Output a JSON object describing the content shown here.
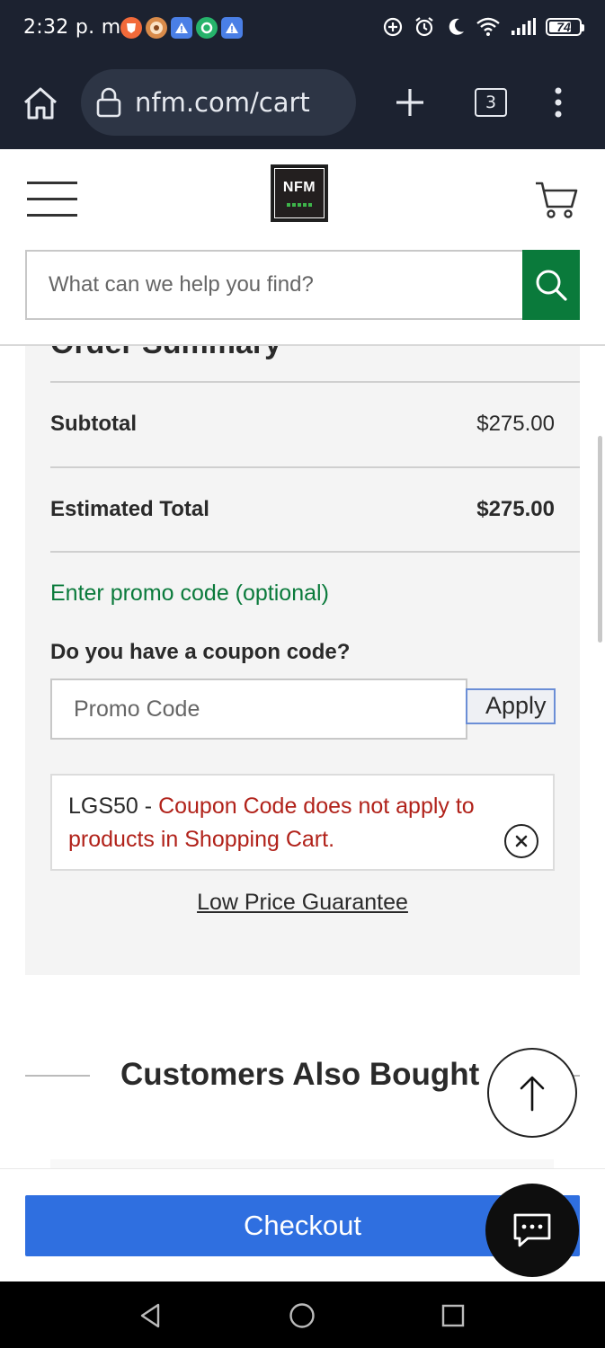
{
  "status_bar": {
    "time": "2:32 p. m.",
    "battery": "74",
    "battery_level": 0.74,
    "left_icons": [
      "brave-icon",
      "chrome-icon",
      "alert-icon",
      "circle-app-icon",
      "alert-icon"
    ],
    "right_icons": [
      "data-saver-icon",
      "alarm-icon",
      "moon-icon",
      "wifi-icon",
      "signal-icon",
      "battery-icon"
    ]
  },
  "browser": {
    "url": "nfm.com/cart",
    "tab_count": "3"
  },
  "site": {
    "logo_text": "NFM",
    "search_placeholder": "What can we help you find?"
  },
  "order_summary": {
    "title": "Order Summary",
    "subtotal_label": "Subtotal",
    "subtotal_value": "$275.00",
    "total_label": "Estimated Total",
    "total_value": "$275.00",
    "promo_link": "Enter promo code (optional)",
    "coupon_question": "Do you have a coupon code?",
    "promo_placeholder": "Promo Code",
    "apply_label": "Apply",
    "error_code": "LGS50 - ",
    "error_message": "Coupon Code does not apply to products in Shopping Cart.",
    "low_price_link": "Low Price Guarantee"
  },
  "recommendations": {
    "title": "Customers Also Bought"
  },
  "checkout": {
    "label": "Checkout"
  },
  "colors": {
    "brand_green": "#0a7a3b",
    "checkout_blue": "#2f6fe0",
    "error_red": "#b1221a",
    "chrome_dark": "#1c2230"
  }
}
